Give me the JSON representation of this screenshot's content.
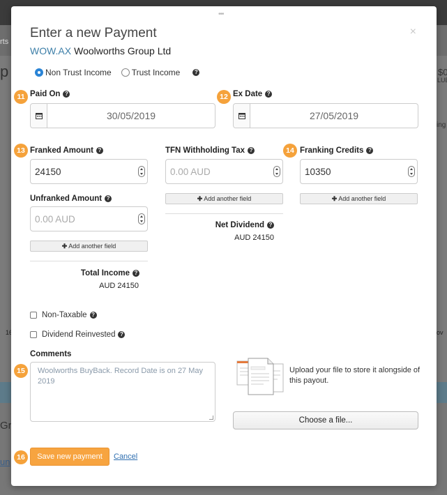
{
  "background": {
    "left_texts": [
      "rts",
      "p",
      "Gr",
      "un",
      "16"
    ],
    "right_texts": [
      "$0",
      "LUE",
      "ing",
      "ov"
    ]
  },
  "modal": {
    "title": "Enter a new Payment",
    "ticker": "WOW.AX",
    "company": "Woolworths Group Ltd",
    "income_type": {
      "options": [
        "Non Trust Income",
        "Trust Income"
      ],
      "selected": "Non Trust Income"
    },
    "paid_on": {
      "badge": "11",
      "label": "Paid On",
      "value": "30/05/2019"
    },
    "ex_date": {
      "badge": "12",
      "label": "Ex Date",
      "value": "27/05/2019"
    },
    "franked_amount": {
      "badge": "13",
      "label": "Franked Amount",
      "value": "24150"
    },
    "unfranked_amount": {
      "label": "Unfranked Amount",
      "placeholder": "0.00 AUD"
    },
    "tfn_withholding": {
      "label": "TFN Withholding Tax",
      "placeholder": "0.00 AUD"
    },
    "franking_credits": {
      "badge": "14",
      "label": "Franking Credits",
      "value": "10350"
    },
    "add_field_label": "Add another field",
    "net_dividend": {
      "label": "Net Dividend",
      "value": "AUD 24150"
    },
    "total_income": {
      "label": "Total Income",
      "value": "AUD 24150"
    },
    "non_taxable_label": "Non-Taxable",
    "dividend_reinvested_label": "Dividend Reinvested",
    "comments": {
      "badge": "15",
      "label": "Comments",
      "value": "Woolworths BuyBack. Record Date is on 27 May 2019"
    },
    "upload": {
      "text": "Upload your file to store it alongside of this payout.",
      "button": "Choose a file..."
    },
    "save": {
      "badge": "16",
      "label": "Save new payment"
    },
    "cancel_label": "Cancel",
    "close_symbol": "×",
    "drag_symbol": "•••"
  },
  "colors": {
    "accent": "#f7a440",
    "link": "#2f6fb0",
    "radio": "#2a84d6",
    "ticker": "#3d7fa8"
  }
}
